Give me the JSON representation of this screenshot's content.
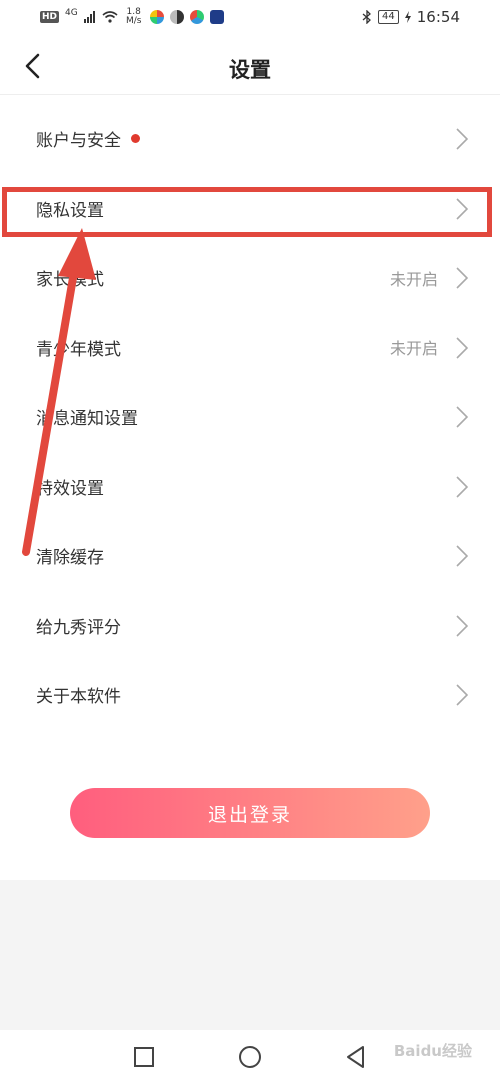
{
  "status_bar": {
    "hd": "HD",
    "network": "4G",
    "speed_value": "1.8",
    "speed_unit": "M/s",
    "battery": "44",
    "time": "16:54"
  },
  "header": {
    "title": "设置"
  },
  "menu": {
    "items": [
      {
        "label": "账户与安全",
        "value": "",
        "has_dot": true
      },
      {
        "label": "隐私设置",
        "value": ""
      },
      {
        "label": "家长模式",
        "value": "未开启"
      },
      {
        "label": "青少年模式",
        "value": "未开启"
      },
      {
        "label": "消息通知设置",
        "value": ""
      },
      {
        "label": "特效设置",
        "value": ""
      },
      {
        "label": "清除缓存",
        "value": ""
      },
      {
        "label": "给九秀评分",
        "value": ""
      },
      {
        "label": "关于本软件",
        "value": ""
      }
    ]
  },
  "logout": {
    "label": "退出登录"
  },
  "watermark": "Baidu经验",
  "colors": {
    "accent_start": "#ff5e7e",
    "accent_end": "#ffa08a",
    "annotation": "#e2483d",
    "dot": "#e03a2e"
  }
}
